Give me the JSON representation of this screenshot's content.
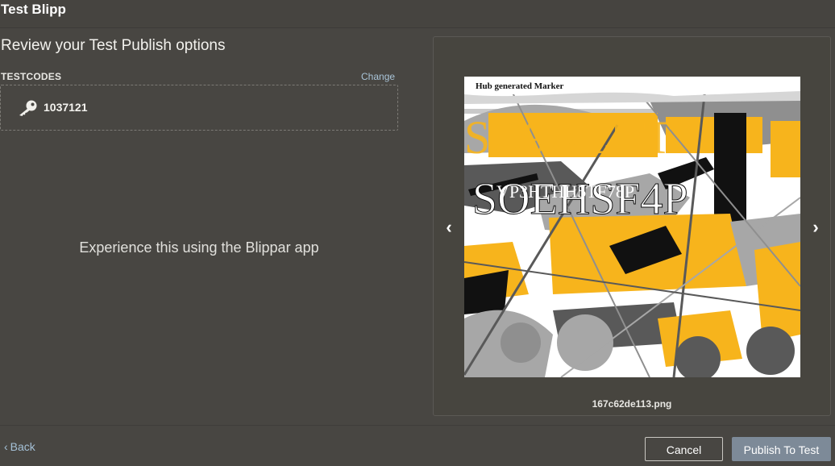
{
  "window": {
    "title": "Test Blipp"
  },
  "review": {
    "heading": "Review your Test Publish options"
  },
  "testcodes": {
    "label": "TESTCODES",
    "change_label": "Change",
    "icon": "key-icon",
    "code": "1037121"
  },
  "main": {
    "message": "Experience this using the Blippar app"
  },
  "preview": {
    "marker_label": "Hub generated Marker",
    "filename": "167c62de113.png",
    "prev_icon": "chevron-left-icon",
    "next_icon": "chevron-right-icon",
    "colors": {
      "accent": "#f7b41c",
      "dark": "#111111",
      "grey": "#a7a7a7",
      "slate": "#595959"
    }
  },
  "footer": {
    "back_label": "Back",
    "cancel_label": "Cancel",
    "publish_label": "Publish To Test"
  }
}
